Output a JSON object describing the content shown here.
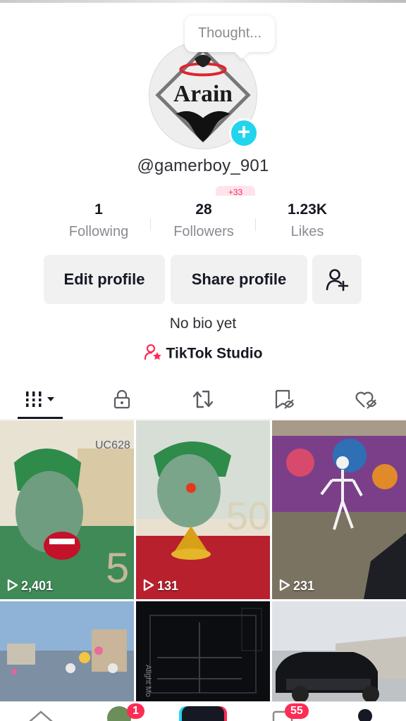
{
  "profile": {
    "thought_bubble": "Thought...",
    "avatar_text": "Arain",
    "username": "@gamerboy_901",
    "badge_text": "+33"
  },
  "stats": [
    {
      "value": "1",
      "label": "Following"
    },
    {
      "value": "28",
      "label": "Followers"
    },
    {
      "value": "1.23K",
      "label": "Likes"
    }
  ],
  "actions": {
    "edit_label": "Edit profile",
    "share_label": "Share profile",
    "add_friends_icon": "add-user-icon"
  },
  "bio": "No bio yet",
  "studio_label": "TikTok Studio",
  "tabs": [
    {
      "icon": "grid-icon",
      "active": true
    },
    {
      "icon": "lock-icon"
    },
    {
      "icon": "repost-icon"
    },
    {
      "icon": "bookmark-icon"
    },
    {
      "icon": "liked-heart-icon"
    }
  ],
  "videos": [
    {
      "views": "2,401",
      "text": "UC628"
    },
    {
      "views": "131",
      "text": "50"
    },
    {
      "views": "231"
    },
    {
      "views": ""
    },
    {
      "views": "",
      "text": "Alight Mo"
    },
    {
      "views": ""
    }
  ],
  "nav": {
    "friends_badge": "1",
    "inbox_badge": "55"
  },
  "colors": {
    "accent": "#fe2c55",
    "cyan": "#20d5ec"
  }
}
